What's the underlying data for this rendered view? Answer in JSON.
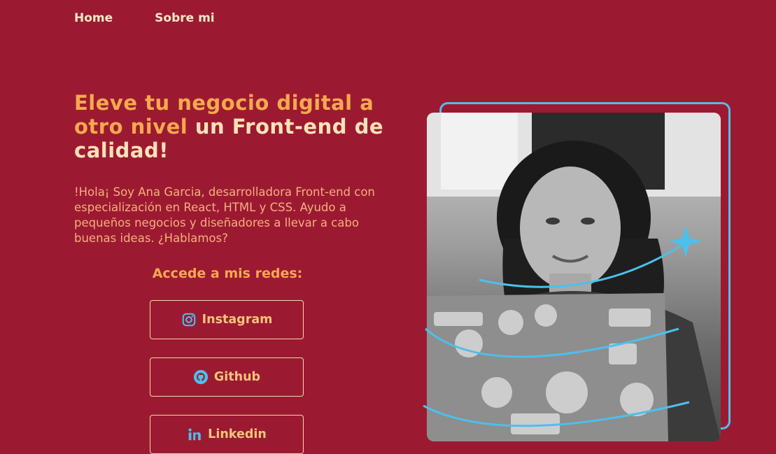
{
  "nav": {
    "home": "Home",
    "about": "Sobre mi"
  },
  "hero": {
    "headline_part1": "Eleve tu negocio digital a otro nivel",
    "headline_part2": " un Front-end de calidad!",
    "intro": "!Hola¡ Soy Ana Garcia, desarrolladora Front-end con especialización en React, HTML y CSS. Ayudo a pequeños negocios y diseñadores a llevar a cabo buenas ideas. ¿Hablamos?"
  },
  "social": {
    "title": "Accede a mis redes:",
    "buttons": [
      {
        "label": "Instagram",
        "icon": "instagram-icon"
      },
      {
        "label": "Github",
        "icon": "github-icon"
      },
      {
        "label": "Linkedin",
        "icon": "linkedin-icon"
      }
    ]
  },
  "colors": {
    "background": "#9c1a31",
    "accent_orange": "#f6a84e",
    "cream": "#fde2b8",
    "frame_blue": "#4cc0ec"
  }
}
